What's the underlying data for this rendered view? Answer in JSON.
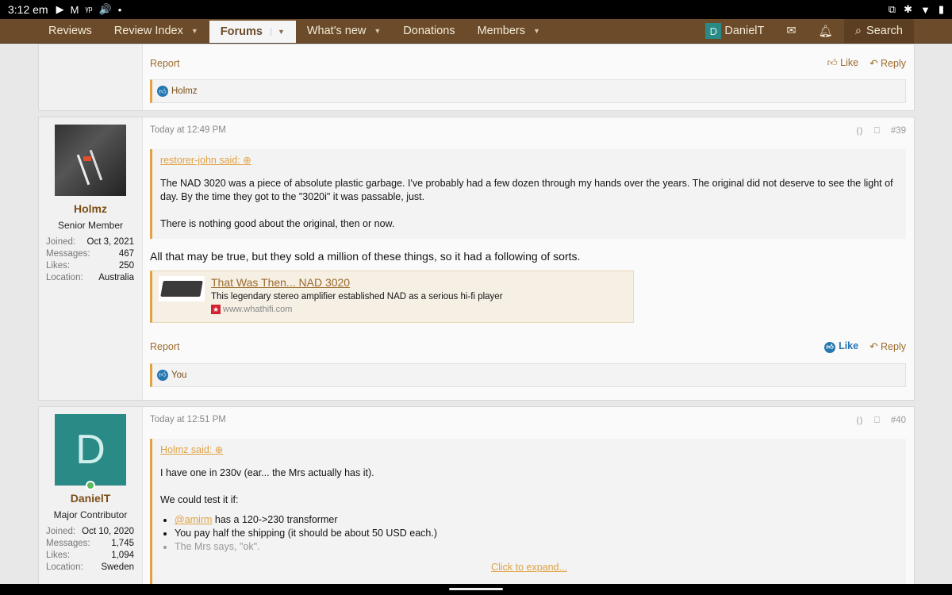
{
  "status": {
    "time": "3:12 em",
    "left_icons": [
      "▶",
      "M",
      "ᵞᵖ",
      "🔊",
      "•"
    ],
    "right_icons": [
      "⧉",
      "✱",
      "▼",
      "▮"
    ]
  },
  "nav": {
    "items": [
      {
        "label": "Reviews",
        "caret": ""
      },
      {
        "label": "Review Index",
        "caret": "▼"
      },
      {
        "label": "Forums",
        "caret": "▼"
      },
      {
        "label": "What's new",
        "caret": "▼"
      },
      {
        "label": "Donations",
        "caret": ""
      },
      {
        "label": "Members",
        "caret": "▼"
      }
    ],
    "user_initial": "D",
    "user_name": "DanielT",
    "search_label": "Search"
  },
  "post_top": {
    "report": "Report",
    "like": "Like",
    "reply": "Reply",
    "liker": "Holmz"
  },
  "post1": {
    "timestamp": "Today at 12:49 PM",
    "number": "#39",
    "user": {
      "name": "Holmz",
      "title": "Senior Member",
      "joined": "Oct 3, 2021",
      "messages": "467",
      "likes": "250",
      "location": "Australia"
    },
    "labels": {
      "joined": "Joined:",
      "messages": "Messages:",
      "likes": "Likes:",
      "location": "Location:"
    },
    "quote": {
      "author": "restorer-john said:",
      "p1": "The NAD 3020 was a piece of absolute plastic garbage. I've probably had a few dozen through my hands over the years. The original did not deserve to see the light of day. By the time they got to the \"3020i\" it was passable, just.",
      "p2": "There is nothing good about the original, then or now."
    },
    "body": "All that may be true, but they sold a million of these things, so it had a following of sorts.",
    "unfurl": {
      "title": "That Was Then... NAD 3020",
      "desc": "This legendary stereo amplifier established NAD as a serious hi-fi player",
      "domain": "www.whathifi.com",
      "fav": "★"
    },
    "report": "Report",
    "like": "Like",
    "reply": "Reply",
    "liker": "You"
  },
  "post2": {
    "timestamp": "Today at 12:51 PM",
    "number": "#40",
    "user": {
      "initial": "D",
      "name": "DanielT",
      "title": "Major Contributor",
      "joined": "Oct 10, 2020",
      "messages": "1,745",
      "likes": "1,094",
      "location": "Sweden"
    },
    "quote": {
      "author": "Holmz said:",
      "p1": "I have one in 230v (ear... the Mrs actually has it).",
      "p2": "We could test it if:",
      "mention": "@amirm",
      "b1": "has a 120->230 transformer",
      "b2": "You pay half the shipping (it should be about 50 USD each.)",
      "b3": "The Mrs says, \"ok\"."
    },
    "expand": "Click to expand..."
  },
  "colors": {
    "nav": "#6b4b2a",
    "accent": "#e0a243",
    "link": "#9c6b2c",
    "avatar": "#2a8a86"
  }
}
